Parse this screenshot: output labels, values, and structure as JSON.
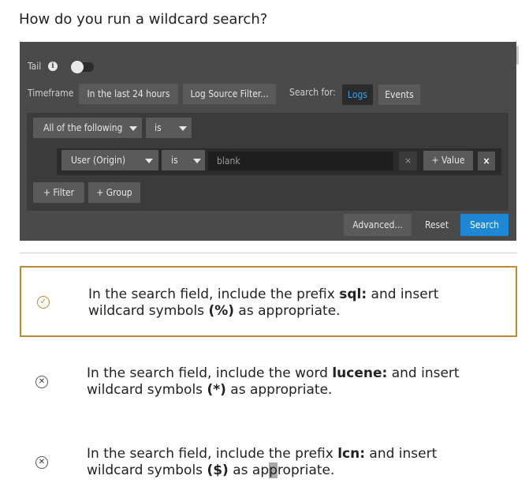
{
  "question": "How do you run a wildcard search?",
  "panel": {
    "tail_label": "Tail",
    "tail_toggle_on": false,
    "timeframe_label": "Timeframe",
    "timeframe_value": "In the last 24 hours",
    "log_source_filter": "Log Source Filter...",
    "search_for_label": "Search for:",
    "logs_tab": "Logs",
    "events_tab": "Events",
    "group_operator": "All of the following",
    "group_is": "is",
    "condition": {
      "field": "User (Origin)",
      "operator": "is",
      "value": "blank",
      "clear_icon": "×",
      "add_value": "+ Value",
      "remove_icon": "×"
    },
    "add_filter": "+ Filter",
    "add_group": "+ Group",
    "advanced": "Advanced...",
    "reset": "Reset",
    "search": "Search"
  },
  "options": [
    {
      "icon": "check-circle-icon",
      "pre": "In the search field, include the prefix ",
      "keyword": "sql:",
      "mid": " and insert wildcard symbols ",
      "symbol": "(%)",
      "post": " as appropriate.",
      "selected": true
    },
    {
      "icon": "x-circle-icon",
      "pre": "In the search field, include the word ",
      "keyword": "lucene:",
      "mid": " and insert wildcard symbols ",
      "symbol": "(*)",
      "post": " as appropriate.",
      "selected": false
    },
    {
      "icon": "x-circle-icon",
      "pre": "In the search field, include the prefix ",
      "keyword": "lcn:",
      "mid": " and insert wildcard symbols ",
      "symbol": "($)",
      "post_a": " as ap",
      "post_cursor": "p",
      "post_b": "ropriate.",
      "selected": false
    }
  ],
  "colors": {
    "panel_bg": "#4a4a4a",
    "accent_blue": "#1e87d6",
    "selected_border": "#c08a2c"
  }
}
